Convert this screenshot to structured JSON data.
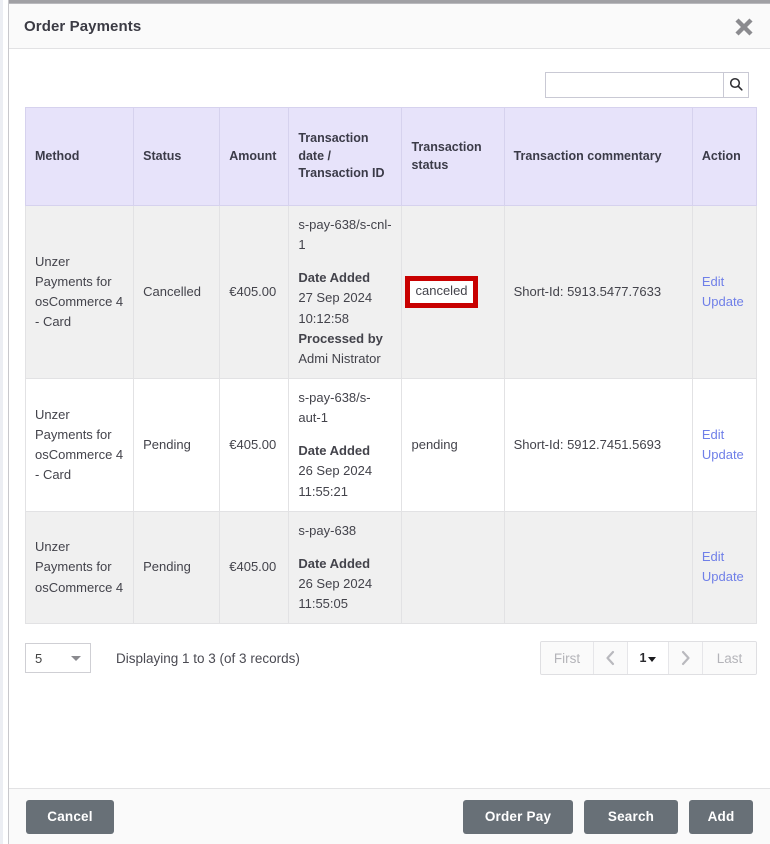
{
  "modal": {
    "title": "Order Payments",
    "close_icon": "close-icon"
  },
  "search": {
    "value": "",
    "placeholder": "",
    "icon": "search-icon"
  },
  "table": {
    "columns": [
      "Method",
      "Status",
      "Amount",
      "Transaction date / Transaction ID",
      "Transaction status",
      "Transaction commentary",
      "Action"
    ],
    "rows": [
      {
        "method": "Unzer Payments for osCommerce 4 - Card",
        "status": "Cancelled",
        "amount": "€405.00",
        "tx_id": "s-pay-638/s-cnl-1",
        "date_added_label": "Date Added",
        "date_added": "27 Sep 2024 10:12:58",
        "processed_by_label": "Processed by",
        "processed_by": "Admi Nistrator",
        "tx_status": "canceled",
        "tx_status_highlighted": true,
        "commentary": "Short-Id: 5913.5477.7633",
        "action_edit": "Edit",
        "action_update": "Update"
      },
      {
        "method": "Unzer Payments for osCommerce 4 - Card",
        "status": "Pending",
        "amount": "€405.00",
        "tx_id": "s-pay-638/s-aut-1",
        "date_added_label": "Date Added",
        "date_added": "26 Sep 2024 11:55:21",
        "processed_by_label": "",
        "processed_by": "",
        "tx_status": "pending",
        "tx_status_highlighted": false,
        "commentary": "Short-Id: 5912.7451.5693",
        "action_edit": "Edit",
        "action_update": "Update"
      },
      {
        "method": "Unzer Payments for osCommerce 4",
        "status": "Pending",
        "amount": "€405.00",
        "tx_id": "s-pay-638",
        "date_added_label": "Date Added",
        "date_added": "26 Sep 2024 11:55:05",
        "processed_by_label": "",
        "processed_by": "",
        "tx_status": "",
        "tx_status_highlighted": false,
        "commentary": "",
        "action_edit": "Edit",
        "action_update": "Update"
      }
    ]
  },
  "footer_bar": {
    "page_size": "5",
    "displaying": "Displaying 1 to 3 (of 3 records)",
    "pager": {
      "first": "First",
      "prev_icon": "chevron-left-icon",
      "current_page": "1",
      "next_icon": "chevron-right-icon",
      "last": "Last"
    }
  },
  "actions": {
    "cancel": "Cancel",
    "order_pay": "Order Pay",
    "search": "Search",
    "add": "Add"
  },
  "colors": {
    "header_bg": "#e7e3fa",
    "highlight_border": "#c80000",
    "link": "#6f7fe8",
    "button_bg": "#687077"
  }
}
